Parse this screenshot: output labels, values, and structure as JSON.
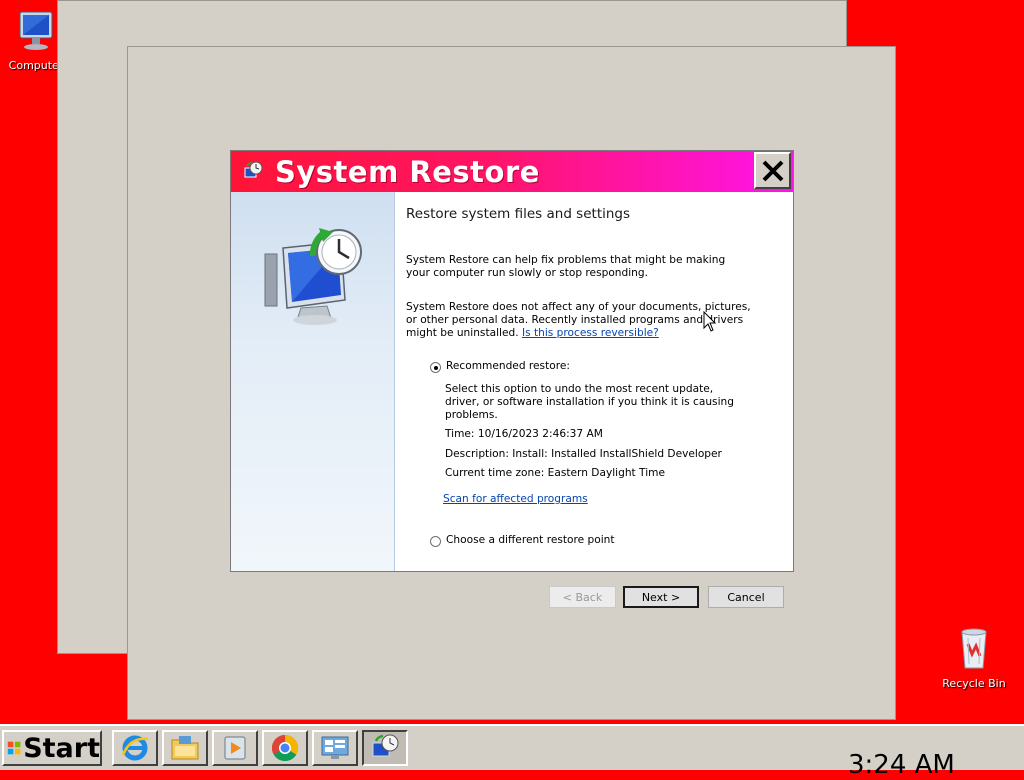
{
  "desktop": {
    "icons": [
      {
        "label": "Computer",
        "icon": "computer-icon"
      },
      {
        "label": "Recycle Bin",
        "icon": "recycle-bin-icon"
      }
    ]
  },
  "dialog": {
    "title": "System Restore",
    "heading": "Restore system files and settings",
    "para1": "System Restore can help fix problems that might be making your computer run slowly or stop responding.",
    "para2": "System Restore does not affect any of your documents, pictures, or other personal data. Recently installed programs and drivers might be uninstalled.",
    "para2_link": "Is this process reversible?",
    "recommended": {
      "label": "Recommended restore:",
      "selected": true,
      "description": "Select this option to undo the most recent update, driver, or software installation if you think it is causing problems.",
      "time": "Time: 10/16/2023 2:46:37 AM",
      "desc": "Description: Install: Installed InstallShield Developer",
      "timezone": "Current time zone: Eastern Daylight Time",
      "scan_link": "Scan for affected programs"
    },
    "different": {
      "label": "Choose a different restore point",
      "selected": false
    },
    "buttons": {
      "back": "< Back",
      "next": "Next >",
      "cancel": "Cancel"
    }
  },
  "taskbar": {
    "start_label": "Start",
    "apps": [
      "internet-explorer-icon",
      "file-explorer-icon",
      "media-player-icon",
      "chrome-icon",
      "control-panel-icon",
      "system-restore-icon"
    ],
    "clock": "3:24 AM"
  },
  "colors": {
    "desktop": "#ff0000",
    "title_start": "#ff1436",
    "title_end": "#ff14e8",
    "window": "#d4d0c8"
  }
}
